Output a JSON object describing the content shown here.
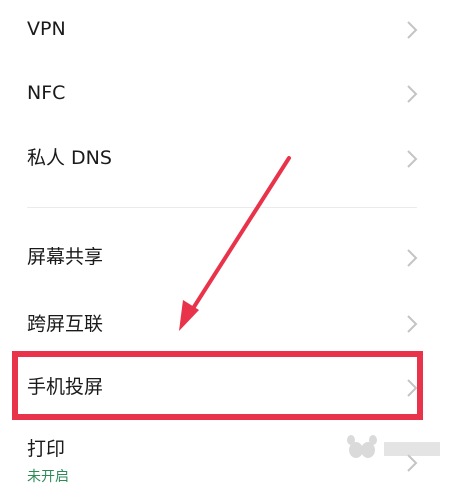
{
  "settings": {
    "items": [
      {
        "label": "VPN",
        "chevron_icon": "chevron-right-icon"
      },
      {
        "label": "NFC",
        "chevron_icon": "chevron-right-icon"
      },
      {
        "label": "私人 DNS",
        "chevron_icon": "chevron-right-icon"
      },
      {
        "label": "屏幕共享",
        "chevron_icon": "chevron-right-icon"
      },
      {
        "label": "跨屏互联",
        "chevron_icon": "chevron-right-icon"
      },
      {
        "label": "手机投屏",
        "chevron_icon": "chevron-right-icon",
        "highlighted": true
      },
      {
        "label": "打印",
        "status": "未开启",
        "chevron_icon": "chevron-right-icon"
      }
    ]
  },
  "annotation": {
    "highlight_color": "#e8334a",
    "arrow_color": "#e8334a"
  },
  "colors": {
    "status_green": "#2e8b57",
    "text": "#1a1a1a",
    "chevron": "#c4c4c4"
  }
}
